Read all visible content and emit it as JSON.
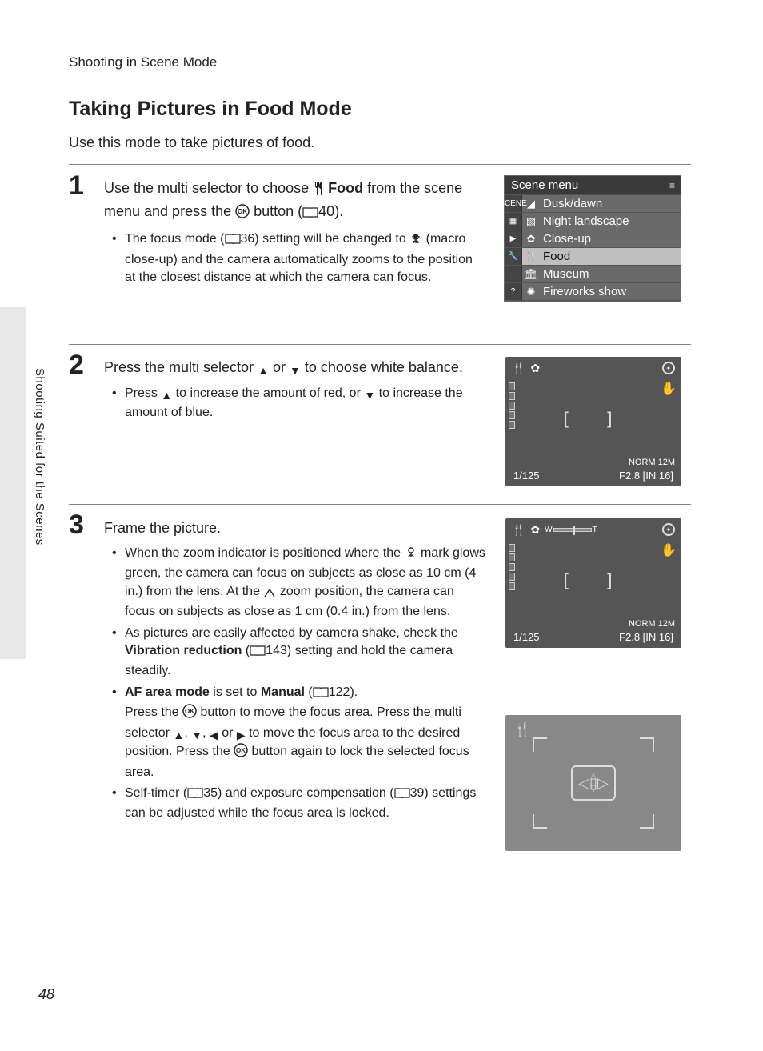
{
  "running_head": "Shooting in Scene Mode",
  "vertical_tab": "Shooting Suited for the Scenes",
  "page_number": "48",
  "title": "Taking Pictures in Food Mode",
  "intro": "Use this mode to take pictures of food.",
  "steps": {
    "s1": {
      "num": "1",
      "head_a": "Use the multi selector to choose ",
      "head_food": "Food",
      "head_b": " from the scene menu and press the ",
      "head_c": " button (",
      "head_page": "40",
      "head_d": ").",
      "bullet1a": "The focus mode (",
      "bullet1_page": "36",
      "bullet1b": ") setting will be changed to ",
      "bullet1c": " (macro close-up) and the camera automatically zooms to the position at the closest distance at which the camera can focus."
    },
    "s2": {
      "num": "2",
      "head_a": "Press the multi selector ",
      "head_b": " or ",
      "head_c": " to choose white balance.",
      "bullet1a": "Press ",
      "bullet1b": " to increase the amount of red, or ",
      "bullet1c": " to increase the amount of blue."
    },
    "s3": {
      "num": "3",
      "head": "Frame the picture.",
      "b1a": "When the zoom indicator is positioned where the ",
      "b1b": " mark glows green, the camera can focus on subjects as close as 10 cm (4 in.) from the lens. At the ",
      "b1c": " zoom position, the camera can focus on subjects as close as 1 cm (0.4 in.) from the lens.",
      "b2a": "As pictures are easily affected by camera shake, check the ",
      "b2_vr": "Vibration reduction",
      "b2b": " (",
      "b2_page": "143",
      "b2c": ") setting and hold the camera steadily.",
      "b3a": "AF area mode",
      "b3b": " is set to ",
      "b3_manual": "Manual",
      "b3c": " (",
      "b3_page": "122",
      "b3d": ").",
      "b3e": "Press the ",
      "b3f": " button to move the focus area. Press the multi selector ",
      "b3g": " or ",
      "b3h": " to move the focus area to the desired position. Press the ",
      "b3i": " button again to lock the selected focus area.",
      "b4a": "Self-timer (",
      "b4_page1": "35",
      "b4b": ") and exposure compensation (",
      "b4_page2": "39",
      "b4c": ") settings can be adjusted while the focus area is locked."
    }
  },
  "scene_menu": {
    "title": "Scene menu",
    "items": [
      {
        "label": "Dusk/dawn"
      },
      {
        "label": "Night landscape"
      },
      {
        "label": "Close-up"
      },
      {
        "label": "Food",
        "selected": true
      },
      {
        "label": "Museum"
      },
      {
        "label": "Fireworks show"
      }
    ]
  },
  "cam": {
    "shutter": "1/125",
    "aperture": "F2.8",
    "norm": "NORM",
    "size": "12M",
    "in": "IN",
    "count": "16"
  }
}
